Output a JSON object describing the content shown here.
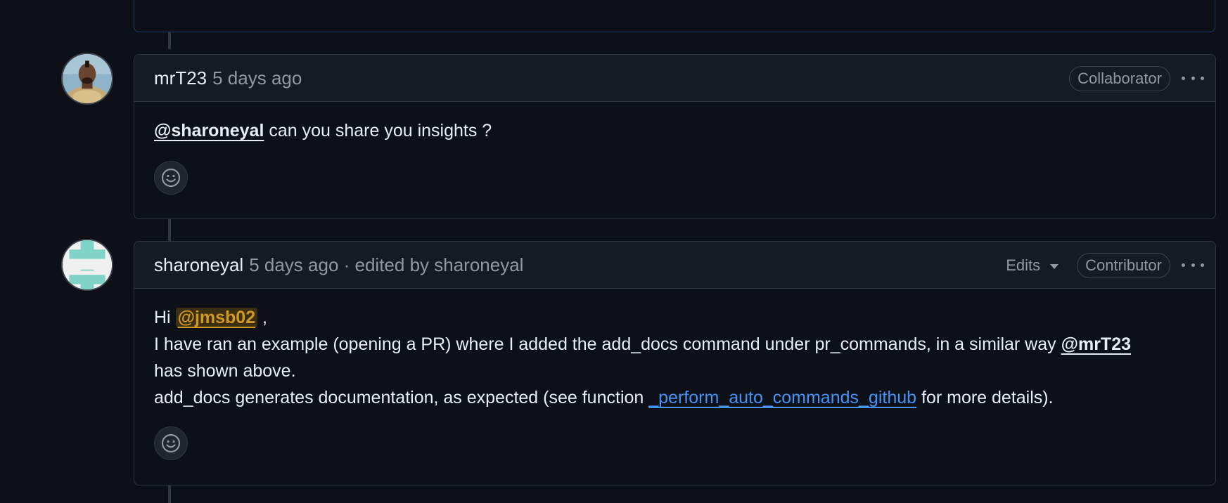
{
  "comments": [
    {
      "author": "mrT23",
      "meta": "5 days ago",
      "role": "Collaborator",
      "body": {
        "mention": "@sharoneyal",
        "text": " can you share you insights ?"
      }
    },
    {
      "author": "sharoneyal",
      "meta": "5 days ago · edited by sharoneyal",
      "edits_label": "Edits",
      "role": "Contributor",
      "body": {
        "greeting": "Hi ",
        "mention_self": "@jmsb02",
        "greeting_tail": " ,",
        "line2_text": "I have ran an example (opening a PR) where I added the add_docs command under pr_commands, in a similar way ",
        "line2_mention": "@mrT23",
        "line3_text": "has shown above.",
        "line4_pre": "add_docs generates documentation, as expected (see function ",
        "line4_link": "_perform_auto_commands_github",
        "line4_post": " for more details)."
      }
    }
  ],
  "icons": {
    "reaction": "smiley-icon",
    "menu": "kebab-horizontal-icon",
    "caret": "triangle-down-icon"
  },
  "colors": {
    "background": "#0d1117",
    "header": "#161b22",
    "border": "#30363d",
    "link": "#4493f8",
    "self_mention": "#d29922",
    "identicon": "#7fd4c7"
  }
}
